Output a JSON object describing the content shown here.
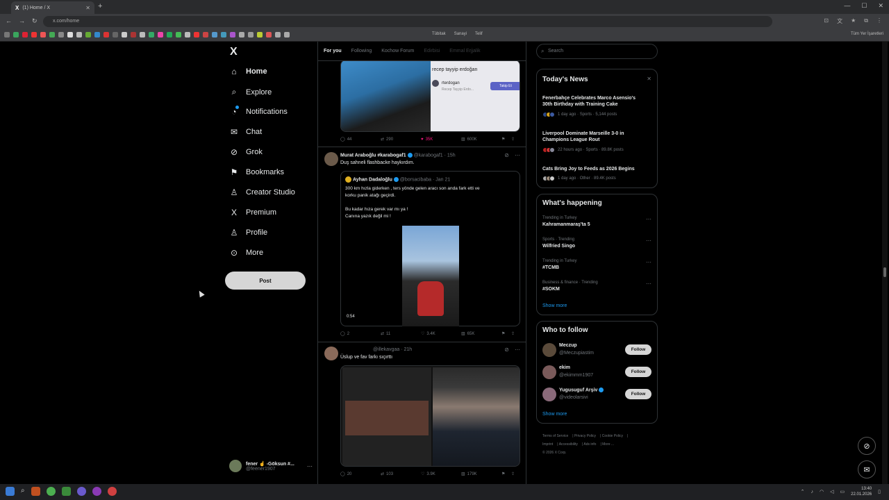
{
  "browser": {
    "tab_title": "(1) Home / X",
    "tab_logo": "X",
    "url": "x.com/home",
    "bookmark_folders": [
      "Tübitak",
      "Sanayi",
      "Telif"
    ],
    "bookmarks_right": "Tüm Yer İşaretleri"
  },
  "nav": {
    "logo": "X",
    "items": [
      {
        "label": "Home",
        "icon": "home-icon",
        "glyph": "⌂"
      },
      {
        "label": "Explore",
        "icon": "search-icon",
        "glyph": "⌕"
      },
      {
        "label": "Notifications",
        "icon": "bell-icon",
        "glyph": "🔔"
      },
      {
        "label": "Chat",
        "icon": "mail-icon",
        "glyph": "✉"
      },
      {
        "label": "Grok",
        "icon": "grok-icon",
        "glyph": "⊘"
      },
      {
        "label": "Bookmarks",
        "icon": "bookmark-icon",
        "glyph": "⚑"
      },
      {
        "label": "Creator Studio",
        "icon": "creator-icon",
        "glyph": "♙"
      },
      {
        "label": "Premium",
        "icon": "x-premium-icon",
        "glyph": "𝕏"
      },
      {
        "label": "Profile",
        "icon": "profile-icon",
        "glyph": "☺"
      },
      {
        "label": "More",
        "icon": "more-icon",
        "glyph": "⋯"
      }
    ],
    "post_label": "Post",
    "account": {
      "name": "fener ☝ -Göksun #...",
      "handle": "@feener1907"
    }
  },
  "timeline": {
    "tabs": [
      "For you",
      "Following",
      "Kochow Forum",
      "Edirbisi",
      "Emmal Erjjalik"
    ],
    "post1": {
      "embedded_name": "recep tayyip erdoğan",
      "embedded_handle": "rterdogan",
      "embedded_sub": "Recep Tayyip Erdo...",
      "embedded_button": "Takip Et",
      "replies": "44",
      "reposts": "290",
      "likes": "35K",
      "views": "600K"
    },
    "post2": {
      "author": "Murat Araboğlu #karabogaf1",
      "handle": "@karabogaf1 · 15h",
      "text": "Duş sahneli flashbacke haykırdım.",
      "quote_author": "Ayhan Dadaloğlu",
      "quote_handle": "@borsacibaba · Jan 21",
      "quote_line1": "300 km hızla giderken , ters yönde gelen aracı son anda fark etti ve",
      "quote_line2": "korku panik atağı geçirdi.",
      "quote_line3": "Bu kadar hıza gerek var mı ya !",
      "quote_line4": "Canına yazık değil mi !",
      "video_duration": "0:54",
      "replies": "2",
      "reposts": "11",
      "likes": "3.4K",
      "views": "65K"
    },
    "post3": {
      "handle": "@illekavgaa · 21h",
      "text": "Üslup ve fav farkı sıçırttı",
      "replies": "20",
      "reposts": "103",
      "likes": "3.9K",
      "views": "179K"
    }
  },
  "search_placeholder": "Search",
  "news": {
    "title": "Today's News",
    "items": [
      {
        "headline": "Fenerbahçe Celebrates Marco Asensio's 30th Birthday with Training Cake",
        "meta": "1 day ago · Sports · 5,144 posts"
      },
      {
        "headline": "Liverpool Dominate Marseille 3-0 in Champions League Rout",
        "meta": "22 hours ago · Sports · 89.8K posts"
      },
      {
        "headline": "Cats Bring Joy to Feeds as 2026 Begins",
        "meta": "1 day ago · Other · 89.4K posts"
      }
    ]
  },
  "happening": {
    "title": "What's happening",
    "trends": [
      {
        "meta": "Trending in Turkey",
        "name": "Kahramanmaraş'ta 5"
      },
      {
        "meta": "Sports · Trending",
        "name": "Wilfried Singo"
      },
      {
        "meta": "Trending in Turkey",
        "name": "#TCMB"
      },
      {
        "meta": "Business & finance · Trending",
        "name": "#SOKM"
      }
    ],
    "show_more": "Show more"
  },
  "who_to_follow": {
    "title": "Who to follow",
    "users": [
      {
        "name": "Meczup",
        "handle": "@Meczupiastim"
      },
      {
        "name": "ekim",
        "handle": "@ekimmm1907"
      },
      {
        "name": "Yugusuguf Arşiv",
        "handle": "@videolarsivi"
      }
    ],
    "follow_label": "Follow",
    "show_more": "Show more"
  },
  "footer": {
    "links": [
      "Terms of Service",
      "Privacy Policy",
      "Cookie Policy",
      "Imprint",
      "Accessibility",
      "Ads info",
      "More ..."
    ],
    "copyright": "© 2026 X Corp."
  },
  "taskbar": {
    "time": "13:40",
    "date": "22.01.2026"
  }
}
